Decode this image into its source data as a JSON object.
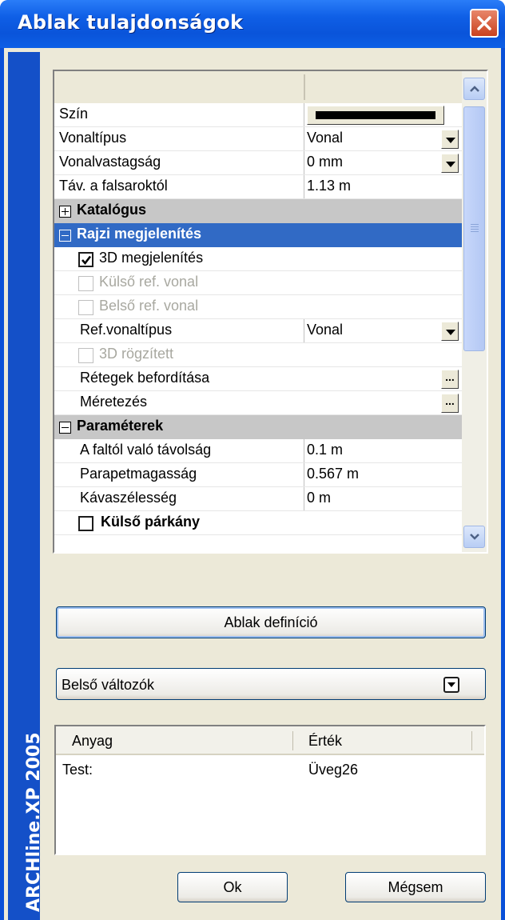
{
  "window": {
    "title": "Ablak tulajdonságok",
    "brand": "ARCHline.XP 2005",
    "colors": {
      "titlebar": "#0a54da",
      "selected_row": "#316ac5",
      "category_row": "#c7c7c7",
      "close_button": "#c9421f"
    }
  },
  "grid": {
    "rows": {
      "szin": {
        "label": "Szín",
        "value_color": "#000000"
      },
      "vonaltipus": {
        "label": "Vonaltípus",
        "value": "Vonal"
      },
      "vonalvastagsag": {
        "label": "Vonalvastagság",
        "value": "0 mm"
      },
      "tav": {
        "label": "Táv. a falsaroktól",
        "value": "1.13 m"
      },
      "katalogus": {
        "label": "Katalógus",
        "expanded": false
      },
      "rajzi": {
        "label": "Rajzi megjelenítés",
        "expanded": true,
        "selected": true
      },
      "megjelenites3d": {
        "label": "3D megjelenítés",
        "checked": true
      },
      "kulso_ref": {
        "label": "Külső ref. vonal",
        "checked": false,
        "disabled": true
      },
      "belso_ref": {
        "label": "Belső ref. vonal",
        "checked": false,
        "disabled": true
      },
      "ref_vonaltipus": {
        "label": "Ref.vonaltípus",
        "value": "Vonal"
      },
      "rogzitett3d": {
        "label": "3D rögzített",
        "checked": false,
        "disabled": true
      },
      "retegek": {
        "label": "Rétegek befordítása",
        "button": "..."
      },
      "meretezes": {
        "label": "Méretezés",
        "button": "..."
      },
      "parameterek": {
        "label": "Paraméterek",
        "expanded": true
      },
      "faltol": {
        "label": "A faltól való távolság",
        "value": "0.1 m"
      },
      "parapet": {
        "label": "Parapetmagasság",
        "value": "0.567 m"
      },
      "kava": {
        "label": "Kávaszélesség",
        "value": "0 m"
      },
      "kulso_parkany": {
        "label": "Külső párkány",
        "checked": false
      }
    }
  },
  "buttons": {
    "definition": "Ablak definíció",
    "ok": "Ok",
    "cancel": "Mégsem"
  },
  "combo": {
    "selected": "Belső változók"
  },
  "list": {
    "columns": [
      "Anyag",
      "Érték"
    ],
    "rows": [
      {
        "anyag": "Test:",
        "ertek": "Üveg26"
      }
    ]
  }
}
